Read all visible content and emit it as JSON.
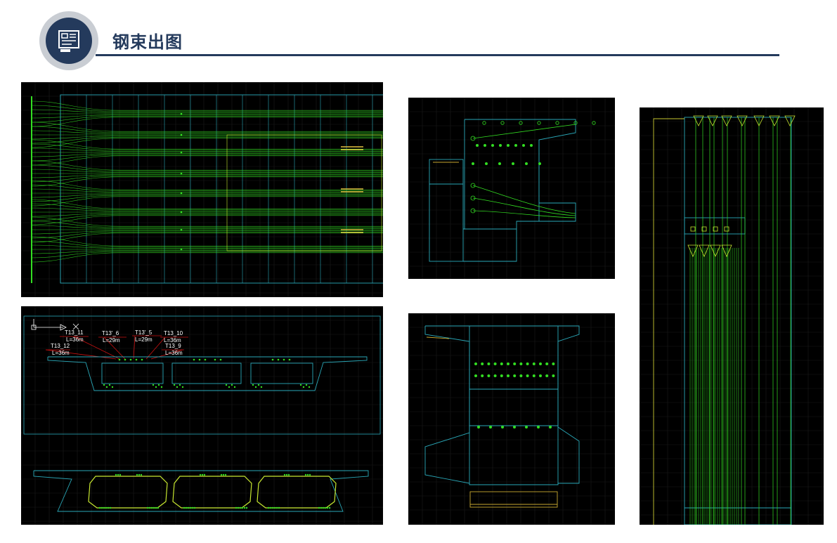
{
  "header": {
    "title": "钢束出图",
    "icon": "blueprint-icon",
    "colors": {
      "brand": "#243a5c",
      "badge_ring": "#c9cdd3"
    }
  },
  "cad": {
    "colors": {
      "background": "#000000",
      "outline": "#2aa8b8",
      "tendon": "#33dd22",
      "highlight": "#c8e830",
      "leader": "#cc1111"
    },
    "section_labels": [
      {
        "id": "T13_11",
        "len": "L=36m"
      },
      {
        "id": "T13'_6",
        "len": "L=29m"
      },
      {
        "id": "T13'_5",
        "len": "L=29m"
      },
      {
        "id": "T13_10",
        "len": "L=36m"
      },
      {
        "id": "T13_12",
        "len": "L=36m"
      },
      {
        "id": "T13_9",
        "len": "L=36m"
      }
    ]
  }
}
